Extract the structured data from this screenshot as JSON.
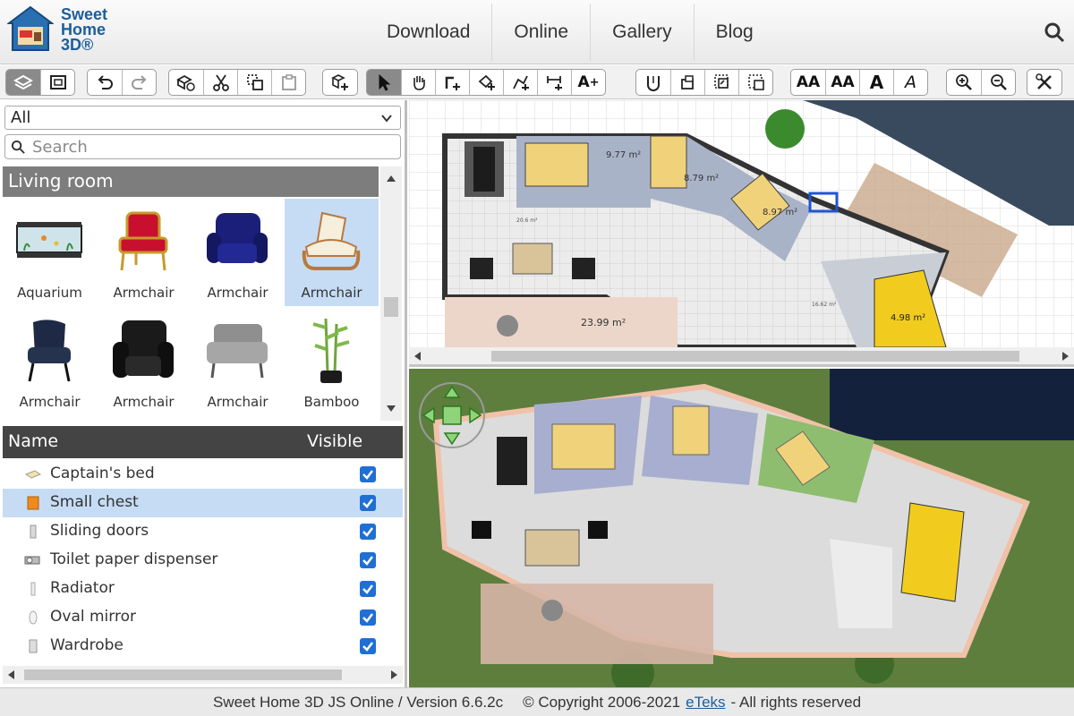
{
  "app": {
    "logo_line1": "Sweet",
    "logo_line2": "Home",
    "logo_line3": "3D®"
  },
  "nav": [
    {
      "label": "Download"
    },
    {
      "label": "Online"
    },
    {
      "label": "Gallery"
    },
    {
      "label": "Blog"
    }
  ],
  "toolbar": {
    "groups": [
      {
        "buttons": [
          "select-catalog-icon",
          "view-3d-icon"
        ]
      },
      {
        "buttons": [
          "undo-icon",
          "redo-icon"
        ]
      },
      {
        "buttons": [
          "add-furniture-icon",
          "cut-icon",
          "copy-icon",
          "paste-icon"
        ]
      },
      {
        "buttons": [
          "add-group-icon"
        ]
      },
      {
        "buttons": [
          "select-arrow-icon",
          "pan-hand-icon",
          "create-walls-icon",
          "create-rooms-icon",
          "create-polylines-icon",
          "create-dimensions-icon",
          "add-text-icon"
        ]
      },
      {
        "buttons": [
          "flip-icon",
          "rotate-icon",
          "duplicate-icon",
          "paste-style-icon"
        ]
      },
      {
        "buttons": [
          "increase-text-icon",
          "decrease-text-icon",
          "bold-text-icon",
          "italic-text-icon"
        ]
      },
      {
        "buttons": [
          "zoom-in-icon",
          "zoom-out-icon"
        ]
      },
      {
        "buttons": [
          "preferences-icon"
        ]
      }
    ],
    "text_increase": "AA",
    "text_decrease": "AA",
    "bold": "A",
    "italic": "A",
    "add_text": "A"
  },
  "catalog": {
    "category_value": "All",
    "search_placeholder": "Search",
    "section_title": "Living room",
    "items": [
      {
        "label": "Aquarium",
        "icon": "aquarium-icon"
      },
      {
        "label": "Armchair",
        "icon": "red-armchair-icon"
      },
      {
        "label": "Armchair",
        "icon": "blue-armchair-icon"
      },
      {
        "label": "Armchair",
        "icon": "wood-armchair-icon",
        "selected": true
      },
      {
        "label": "Armchair",
        "icon": "navy-armchair-icon"
      },
      {
        "label": "Armchair",
        "icon": "leather-armchair-icon"
      },
      {
        "label": "Armchair",
        "icon": "grey-armchair-icon"
      },
      {
        "label": "Bamboo",
        "icon": "bamboo-icon"
      }
    ]
  },
  "furniture_table": {
    "col_name": "Name",
    "col_visible": "Visible",
    "rows": [
      {
        "name": "Captain's bed",
        "icon": "bed-icon"
      },
      {
        "name": "Small chest",
        "icon": "chest-icon",
        "selected": true
      },
      {
        "name": "Sliding doors",
        "icon": "door-icon"
      },
      {
        "name": "Toilet paper dispenser",
        "icon": "toilet-paper-icon"
      },
      {
        "name": "Radiator",
        "icon": "radiator-icon"
      },
      {
        "name": "Oval mirror",
        "icon": "mirror-icon"
      },
      {
        "name": "Wardrobe",
        "icon": "wardrobe-icon"
      }
    ]
  },
  "plan": {
    "areas": [
      "9.77 m²",
      "8.79 m²",
      "8.97 m²",
      "23.99 m²",
      "4.98 m²",
      "20.6 m²",
      "16.62 m²"
    ]
  },
  "footer": {
    "prefix": "Sweet Home 3D JS Online / Version 6.6.2c",
    "copyright": "© Copyright 2006-2021",
    "link": "eTeks",
    "suffix": "- All rights reserved"
  },
  "colors": {
    "brand": "#1d5e9c",
    "selection": "#c6dcf5",
    "checkbox": "#1f6fd4"
  }
}
